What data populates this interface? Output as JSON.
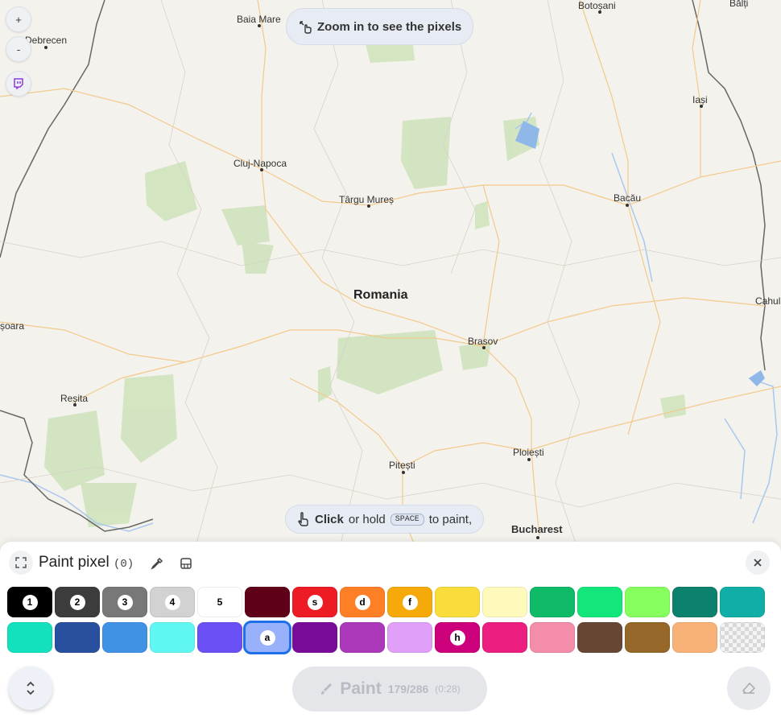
{
  "map": {
    "country_label": "Romania",
    "cities": [
      {
        "name": "Baia Mare"
      },
      {
        "name": "Debrecen"
      },
      {
        "name": "Botoșani"
      },
      {
        "name": "Bălți"
      },
      {
        "name": "Iași"
      },
      {
        "name": "Cluj-Napoca"
      },
      {
        "name": "Târgu Mureș"
      },
      {
        "name": "Bacău"
      },
      {
        "name": "Cahul"
      },
      {
        "name": "șoara"
      },
      {
        "name": "Brasov"
      },
      {
        "name": "Reșita"
      },
      {
        "name": "Ploiești"
      },
      {
        "name": "Pitești"
      },
      {
        "name": "Bucharest"
      }
    ],
    "controls": {
      "zoom_in": "+",
      "zoom_out": "-",
      "twitch_icon": "twitch-icon"
    }
  },
  "hints": {
    "zoom_hint": "Zoom in to see the pixels",
    "paint_hint": {
      "click": "Click",
      "rest": "or hold",
      "key": "SPACE",
      "tail": "to paint,"
    }
  },
  "panel": {
    "title": "Paint pixel",
    "count": "(0)",
    "paint_button": {
      "label": "Paint",
      "count": "179/286",
      "timer": "(0:28)"
    },
    "palette": {
      "row1": [
        {
          "color": "#000000",
          "key": "1"
        },
        {
          "color": "#3c3c3c",
          "key": "2"
        },
        {
          "color": "#787878",
          "key": "3"
        },
        {
          "color": "#d2d2d2",
          "key": "4"
        },
        {
          "color": "#ffffff",
          "key": "5"
        },
        {
          "color": "#600018",
          "key": ""
        },
        {
          "color": "#ed1c24",
          "key": "s"
        },
        {
          "color": "#ff7f27",
          "key": "d"
        },
        {
          "color": "#f6aa09",
          "key": "f"
        },
        {
          "color": "#f9dd3b",
          "key": ""
        },
        {
          "color": "#fffabc",
          "key": ""
        },
        {
          "color": "#0eb968",
          "key": ""
        },
        {
          "color": "#13e67b",
          "key": ""
        },
        {
          "color": "#87ff5e",
          "key": ""
        },
        {
          "color": "#0c816e",
          "key": ""
        },
        {
          "color": "#10aea6",
          "key": ""
        }
      ],
      "row2": [
        {
          "color": "#13e1be",
          "key": ""
        },
        {
          "color": "#28509e",
          "key": ""
        },
        {
          "color": "#4093e4",
          "key": ""
        },
        {
          "color": "#60f7f2",
          "key": ""
        },
        {
          "color": "#6b50f6",
          "key": ""
        },
        {
          "color": "#99b1fb",
          "key": "a"
        },
        {
          "color": "#780c99",
          "key": ""
        },
        {
          "color": "#aa38b9",
          "key": ""
        },
        {
          "color": "#e09ff9",
          "key": ""
        },
        {
          "color": "#cb007a",
          "key": "h"
        },
        {
          "color": "#ec1f80",
          "key": ""
        },
        {
          "color": "#f38da9",
          "key": ""
        },
        {
          "color": "#684634",
          "key": ""
        },
        {
          "color": "#95682a",
          "key": ""
        },
        {
          "color": "#f8b277",
          "key": ""
        },
        {
          "color": "transparent",
          "key": ""
        }
      ],
      "selected_color": "#99b1fb"
    }
  }
}
